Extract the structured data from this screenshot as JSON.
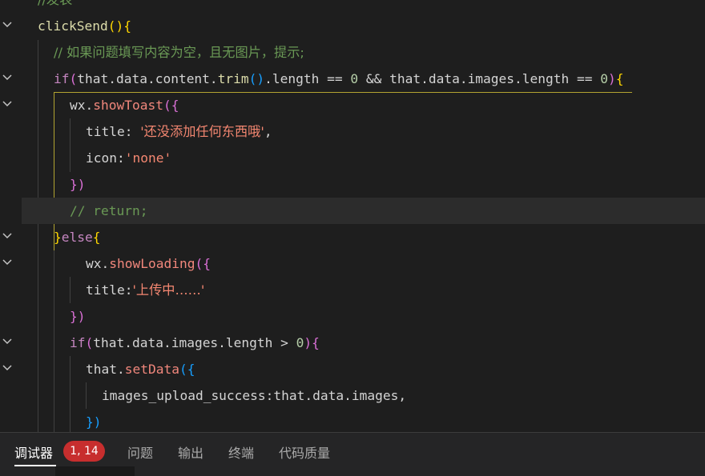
{
  "editor": {
    "lines": [
      {
        "fold": false,
        "tokens": [
          {
            "t": "//发表",
            "c": "cmt"
          }
        ]
      },
      {
        "fold": true,
        "tokens": [
          {
            "t": "clickSend",
            "c": "fn"
          },
          {
            "t": "(){",
            "c": "p1"
          }
        ]
      },
      {
        "fold": false,
        "tokens": [
          {
            "t": "// 如果问题填写内容为空，且无图片，提示;",
            "c": "cmt"
          }
        ]
      },
      {
        "fold": true,
        "tokens": [
          {
            "t": "if",
            "c": "kw"
          },
          {
            "t": "(",
            "c": "p2"
          },
          {
            "t": "that.data.content.",
            "c": "var"
          },
          {
            "t": "trim",
            "c": "fn"
          },
          {
            "t": "()",
            "c": "p3"
          },
          {
            "t": ".length == ",
            "c": "var"
          },
          {
            "t": "0",
            "c": "num"
          },
          {
            "t": " && ",
            "c": "op"
          },
          {
            "t": "that.data.images.length == ",
            "c": "var"
          },
          {
            "t": "0",
            "c": "num"
          },
          {
            "t": ")",
            "c": "p2"
          },
          {
            "t": "{",
            "c": "p1"
          }
        ]
      },
      {
        "fold": true,
        "tokens": [
          {
            "t": "wx.",
            "c": "var"
          },
          {
            "t": "showToast",
            "c": "mth"
          },
          {
            "t": "({",
            "c": "p2"
          }
        ]
      },
      {
        "fold": false,
        "tokens": [
          {
            "t": "title: ",
            "c": "var"
          },
          {
            "t": "'还没添加任何东西哦'",
            "c": "str"
          },
          {
            "t": ",",
            "c": "var"
          }
        ]
      },
      {
        "fold": false,
        "tokens": [
          {
            "t": "icon:",
            "c": "var"
          },
          {
            "t": "'none'",
            "c": "str"
          }
        ]
      },
      {
        "fold": false,
        "tokens": [
          {
            "t": "})",
            "c": "p2"
          }
        ]
      },
      {
        "fold": false,
        "tokens": [
          {
            "t": "// return;",
            "c": "cmt"
          }
        ]
      },
      {
        "fold": true,
        "tokens": [
          {
            "t": "}",
            "c": "p1"
          },
          {
            "t": "else",
            "c": "kw"
          },
          {
            "t": "{",
            "c": "p1"
          }
        ]
      },
      {
        "fold": true,
        "tokens": [
          {
            "t": "wx.",
            "c": "var"
          },
          {
            "t": "showLoading",
            "c": "mth"
          },
          {
            "t": "({",
            "c": "p2"
          }
        ]
      },
      {
        "fold": false,
        "tokens": [
          {
            "t": "title:",
            "c": "var"
          },
          {
            "t": "'上传中……'",
            "c": "str"
          }
        ]
      },
      {
        "fold": false,
        "tokens": [
          {
            "t": "})",
            "c": "p2"
          }
        ]
      },
      {
        "fold": true,
        "tokens": [
          {
            "t": "if",
            "c": "kw"
          },
          {
            "t": "(",
            "c": "p2"
          },
          {
            "t": "that.data.images.length > ",
            "c": "var"
          },
          {
            "t": "0",
            "c": "num"
          },
          {
            "t": ")",
            "c": "p2"
          },
          {
            "t": "{",
            "c": "p2"
          }
        ]
      },
      {
        "fold": true,
        "tokens": [
          {
            "t": "that.",
            "c": "var"
          },
          {
            "t": "setData",
            "c": "mth"
          },
          {
            "t": "({",
            "c": "p3"
          }
        ]
      },
      {
        "fold": false,
        "tokens": [
          {
            "t": "images_upload_success:that.data.images,",
            "c": "var"
          }
        ]
      },
      {
        "fold": false,
        "tokens": [
          {
            "t": "})",
            "c": "p3"
          }
        ]
      }
    ]
  },
  "panel": {
    "tabs": [
      {
        "label": "调试器",
        "active": true
      },
      {
        "label": "问题",
        "active": false
      },
      {
        "label": "输出",
        "active": false
      },
      {
        "label": "终端",
        "active": false
      },
      {
        "label": "代码质量",
        "active": false
      }
    ],
    "badge": "1, 14"
  },
  "icons": {
    "fold": "chevron-down-icon"
  }
}
